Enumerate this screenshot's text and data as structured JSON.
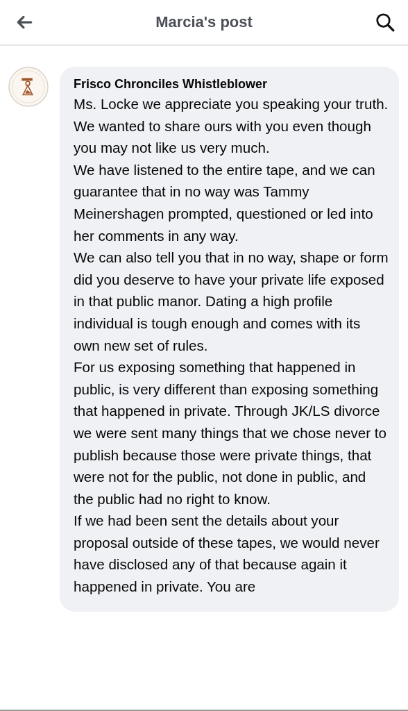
{
  "header": {
    "title": "Marcia's post"
  },
  "comment": {
    "author": "Frisco Chronciles Whistleblower",
    "paragraphs": [
      "Ms. Locke we appreciate you speaking your truth. We wanted to share ours with you even though you may not like us very much.",
      "We have listened to the entire tape, and we can guarantee that in no way was Tammy Meinershagen prompted, questioned or led into her comments in any way.",
      "We can also tell you that in no way, shape or form did you deserve to have your private life exposed in that public manor. Dating a high profile individual is tough enough and comes with its own new set of rules.",
      "For us exposing something that happened in public, is very different than exposing something that happened in private. Through JK/LS divorce we were sent many things that we chose never to publish because those were private things, that were not for the public, not done in public, and the public had no right to know.",
      "If we had been sent the details about your proposal outside of these tapes, we would never have disclosed any of that because again it happened in private. You are"
    ]
  }
}
